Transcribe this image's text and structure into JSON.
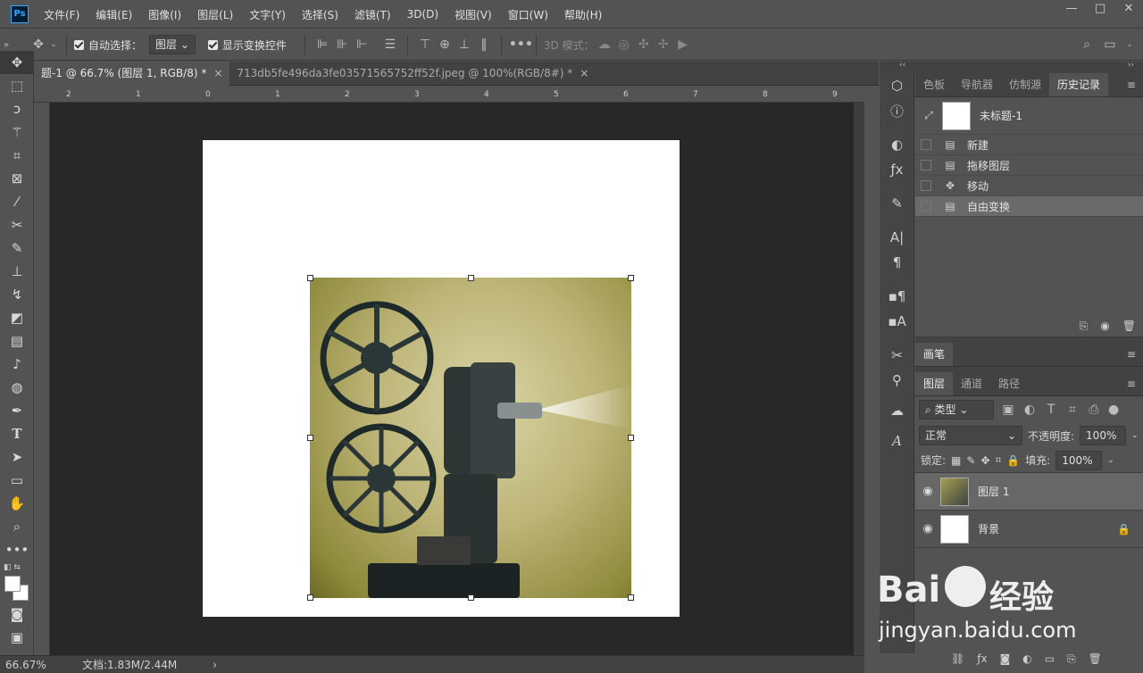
{
  "app": {
    "logo": "Ps"
  },
  "menu": [
    "文件(F)",
    "编辑(E)",
    "图像(I)",
    "图层(L)",
    "文字(Y)",
    "选择(S)",
    "滤镜(T)",
    "3D(D)",
    "视图(V)",
    "窗口(W)",
    "帮助(H)"
  ],
  "window_controls": {
    "minimize": "—",
    "maximize": "□",
    "close": "✕"
  },
  "options": {
    "auto_select_label": "自动选择：",
    "auto_select_value": "图层",
    "show_transform_label": "显示变换控件",
    "mode_3d_label": "3D 模式："
  },
  "tabs": [
    {
      "label": "题-1 @ 66.7% (图层 1, RGB/8) *",
      "close": "×"
    },
    {
      "label": "713db5fe496da3fe03571565752ff52f.jpeg @ 100%(RGB/8#) *",
      "close": "×"
    }
  ],
  "ruler_labels": [
    "2",
    "1",
    "0",
    "1",
    "2",
    "3",
    "4",
    "5",
    "6",
    "7",
    "8",
    "9"
  ],
  "status": {
    "zoom": "66.67%",
    "doc": "文档:1.83M/2.44M"
  },
  "history_panel": {
    "tabs": [
      "色板",
      "导航器",
      "仿制源",
      "历史记录"
    ],
    "snapshot": "未标题-1",
    "items": [
      {
        "icon": "doc-icon",
        "label": "新建"
      },
      {
        "icon": "doc-icon",
        "label": "拖移图层"
      },
      {
        "icon": "move-icon",
        "label": "移动"
      },
      {
        "icon": "doc-icon",
        "label": "自由变换"
      }
    ]
  },
  "brush_panel": {
    "tab": "画笔"
  },
  "layers_panel": {
    "tabs": [
      "图层",
      "通道",
      "路径"
    ],
    "filter_kind": "类型",
    "blend_mode": "正常",
    "opacity_label": "不透明度:",
    "opacity_value": "100%",
    "lock_label": "锁定:",
    "fill_label": "填充:",
    "fill_value": "100%",
    "layers": [
      {
        "name": "图层 1",
        "selected": true,
        "locked": false
      },
      {
        "name": "背景",
        "selected": false,
        "locked": true
      }
    ]
  },
  "watermark": {
    "brand": "Bai",
    "brand2": "经验",
    "url": "jingyan.baidu.com"
  },
  "colors": {
    "accent": "#31a8ff",
    "canvas": "#282828",
    "panel": "#535353"
  }
}
